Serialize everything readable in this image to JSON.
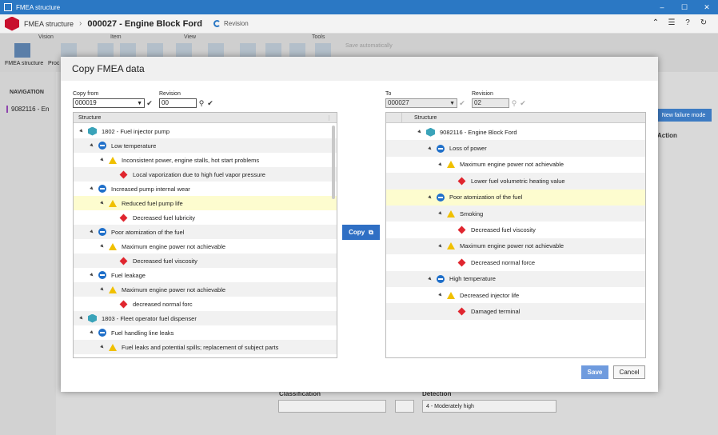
{
  "window": {
    "title": "FMEA structure"
  },
  "header": {
    "module": "FMEA structure",
    "document": "000027 - Engine Block Ford",
    "revision_label": "Revision"
  },
  "ribbon": {
    "groups": [
      "Vision",
      "Item",
      "View",
      "Tools"
    ],
    "fmea_structure_label": "FMEA structure",
    "pro_label": "Proc",
    "autosave_label": "Save automatically"
  },
  "navigation": {
    "label": "NAVIGATION",
    "item": "9082116 - En"
  },
  "background": {
    "new_failure_mode": "New failure mode",
    "col_action": "Action",
    "classification_label": "Classification",
    "detection_label": "Detection",
    "detection_value": "4 - Moderately high"
  },
  "dialog": {
    "title": "Copy FMEA data",
    "copy_from_label": "Copy from",
    "copy_from_value": "000019",
    "revision_label": "Revision",
    "source_revision": "00",
    "to_label": "To",
    "to_value": "000027",
    "target_revision": "02",
    "structure_header": "Structure",
    "copy_button": "Copy",
    "save_button": "Save",
    "cancel_button": "Cancel",
    "source_tree": [
      {
        "label": "1802 - Fuel injector pump",
        "icon": "cube",
        "level": 0
      },
      {
        "label": "Low temperature",
        "icon": "minus",
        "level": 1
      },
      {
        "label": "Inconsistent power, engine stalls, hot start problems",
        "icon": "warn",
        "level": 2
      },
      {
        "label": "Local vaporization due to high fuel vapor pressure",
        "icon": "diam",
        "level": 3
      },
      {
        "label": "Increased pump internal wear",
        "icon": "minus",
        "level": 1
      },
      {
        "label": "Reduced fuel pump life",
        "icon": "warn",
        "level": 2,
        "highlight": true
      },
      {
        "label": "Decreased fuel lubricity",
        "icon": "diam",
        "level": 3
      },
      {
        "label": "Poor atomization of the fuel",
        "icon": "minus",
        "level": 1
      },
      {
        "label": "Maximum engine power not achievable",
        "icon": "warn",
        "level": 2
      },
      {
        "label": "Decreased fuel viscosity",
        "icon": "diam",
        "level": 3
      },
      {
        "label": "Fuel leakage",
        "icon": "minus",
        "level": 1
      },
      {
        "label": "Maximum engine power not achievable",
        "icon": "warn",
        "level": 2
      },
      {
        "label": "decreased normal forc",
        "icon": "diam",
        "level": 3
      },
      {
        "label": "1803 - Fleet operator fuel dispenser",
        "icon": "cube",
        "level": 0
      },
      {
        "label": "Fuel handling line leaks",
        "icon": "minus",
        "level": 1
      },
      {
        "label": "Fuel leaks and potential spills; replacement of subject parts",
        "icon": "warn",
        "level": 2
      }
    ],
    "target_tree": [
      {
        "label": "9082116 - Engine Block Ford",
        "icon": "cube",
        "level": 0
      },
      {
        "label": "Loss of power",
        "icon": "minus",
        "level": 1
      },
      {
        "label": "Maximum engine power not achievable",
        "icon": "warn",
        "level": 2
      },
      {
        "label": "Lower fuel volumetric heating value",
        "icon": "diam",
        "level": 3
      },
      {
        "label": "Poor atomization of the fuel",
        "icon": "minus",
        "level": 1,
        "highlight": true
      },
      {
        "label": "Smoking",
        "icon": "warn",
        "level": 2
      },
      {
        "label": "Decreased fuel viscosity",
        "icon": "diam",
        "level": 3
      },
      {
        "label": "Maximum engine power not achievable",
        "icon": "warn",
        "level": 2
      },
      {
        "label": "Decreased normal force",
        "icon": "diam",
        "level": 3
      },
      {
        "label": "High temperature",
        "icon": "minus",
        "level": 1
      },
      {
        "label": "Decreased injector life",
        "icon": "warn",
        "level": 2
      },
      {
        "label": "Damaged terminal",
        "icon": "diam",
        "level": 3
      }
    ]
  }
}
